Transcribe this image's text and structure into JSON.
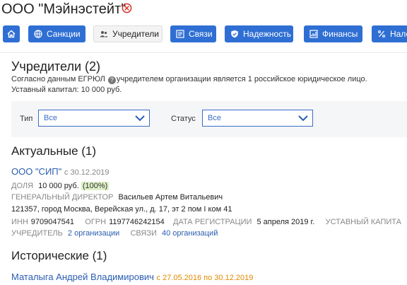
{
  "header": {
    "title": "ООО \"Мэйнэстейт\""
  },
  "toolbar": {
    "items": [
      {
        "label": "",
        "icon": "home-icon"
      },
      {
        "label": "Санкции",
        "icon": "globe-icon"
      },
      {
        "label": "Учредители",
        "icon": "people-icon",
        "active": true
      },
      {
        "label": "Связи",
        "icon": "network-icon"
      },
      {
        "label": "Надежность",
        "icon": "shield-check-icon"
      },
      {
        "label": "Финансы",
        "icon": "chart-icon"
      },
      {
        "label": "Налог",
        "icon": "percent-icon"
      }
    ]
  },
  "founders": {
    "heading": "Учредители (2)",
    "note_before": "Согласно данным ЕГРЮЛ",
    "note_after": "учредителем организации является 1 российское юридическое лицо.",
    "capital": "Уставный капитал: 10 000 руб."
  },
  "filters": {
    "type_label": "Тип",
    "type_value": "Все",
    "status_label": "Статус",
    "status_value": "Все"
  },
  "actual": {
    "heading": "Актуальные (1)",
    "name": "ООО \"СИП\"",
    "since": "с 30.12.2019",
    "share_label": "ДОЛЯ",
    "share_value": "10 000 руб.",
    "share_percent": "(100%)",
    "director_label": "ГЕНЕРАЛЬНЫЙ ДИРЕКТОР",
    "director_value": "Васильев Артем Витальевич",
    "address": "121357, город Москва, Верейская ул., д. 17, эт 2 пом I ком 41",
    "inn_label": "ИНН",
    "inn_value": "9709047541",
    "ogrn_label": "ОГРН",
    "ogrn_value": "1197746242154",
    "reg_label": "ДАТА РЕГИСТРАЦИИ",
    "reg_value": "5 апреля 2019 г.",
    "capital_label": "УСТАВНЫЙ КАПИТА",
    "founder_label": "УЧРЕДИТЕЛЬ",
    "founder_value": "2 организации",
    "links_label": "СВЯЗИ",
    "links_value": "40 организаций"
  },
  "historic": {
    "heading": "Исторические (1)",
    "name": "Маталыга Андрей Владимирович",
    "period": "с 27.05.2016 по 30.12.2019"
  }
}
